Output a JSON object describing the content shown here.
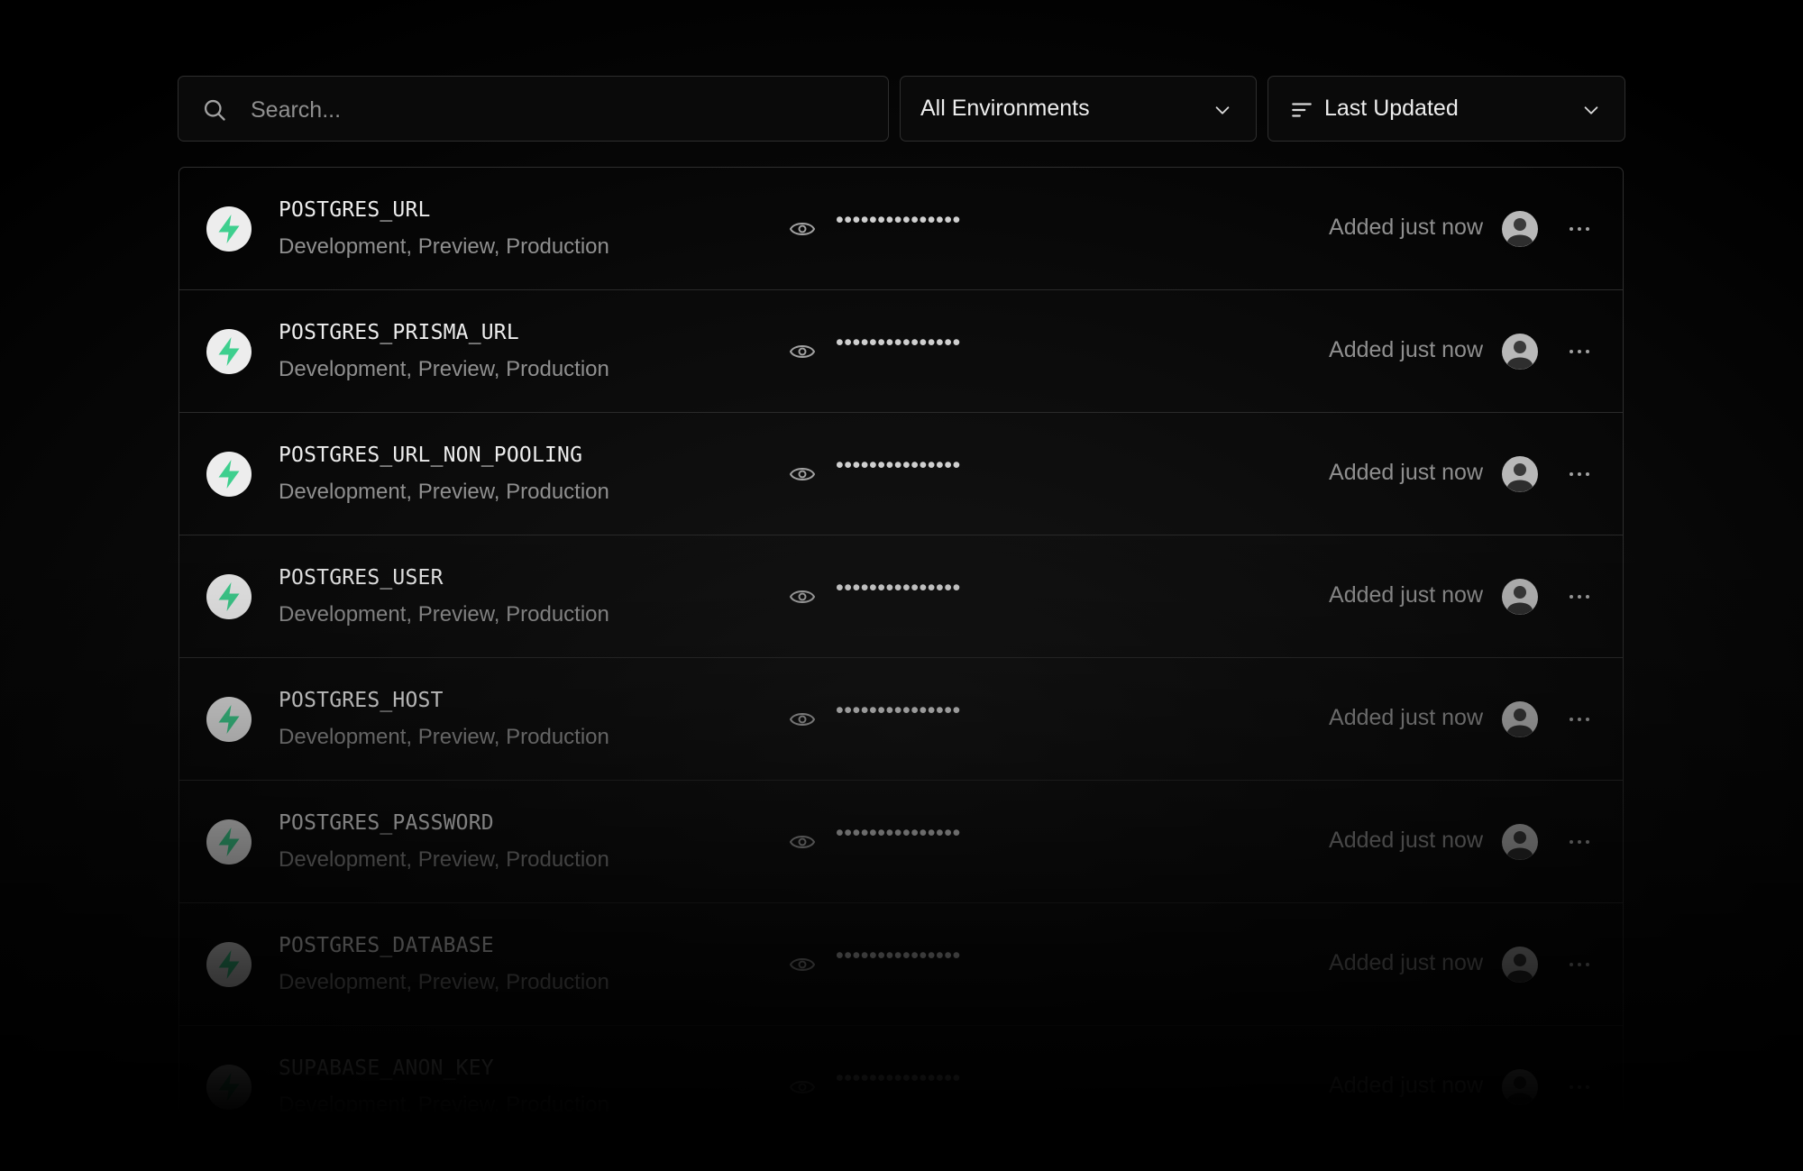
{
  "search": {
    "placeholder": "Search...",
    "value": ""
  },
  "filters": {
    "environment_label": "All Environments",
    "sort_label": "Last Updated"
  },
  "colors": {
    "background": "#000000",
    "border": "#2e2e2e",
    "supabase_green": "#3ecf8e",
    "muted_text": "#8f8f8f"
  },
  "variables": [
    {
      "name": "POSTGRES_URL",
      "environments": "Development, Preview, Production",
      "value_masked": "•••••••••••••••",
      "updated": "Added just now"
    },
    {
      "name": "POSTGRES_PRISMA_URL",
      "environments": "Development, Preview, Production",
      "value_masked": "•••••••••••••••",
      "updated": "Added just now"
    },
    {
      "name": "POSTGRES_URL_NON_POOLING",
      "environments": "Development, Preview, Production",
      "value_masked": "•••••••••••••••",
      "updated": "Added just now"
    },
    {
      "name": "POSTGRES_USER",
      "environments": "Development, Preview, Production",
      "value_masked": "•••••••••••••••",
      "updated": "Added just now"
    },
    {
      "name": "POSTGRES_HOST",
      "environments": "Development, Preview, Production",
      "value_masked": "•••••••••••••••",
      "updated": "Added just now"
    },
    {
      "name": "POSTGRES_PASSWORD",
      "environments": "Development, Preview, Production",
      "value_masked": "•••••••••••••••",
      "updated": "Added just now"
    },
    {
      "name": "POSTGRES_DATABASE",
      "environments": "Development, Preview, Production",
      "value_masked": "•••••••••••••••",
      "updated": "Added just now"
    },
    {
      "name": "SUPABASE_ANON_KEY",
      "environments": "Development, Preview, Production",
      "value_masked": "•••••••••••••••",
      "updated": "Added just now"
    }
  ]
}
